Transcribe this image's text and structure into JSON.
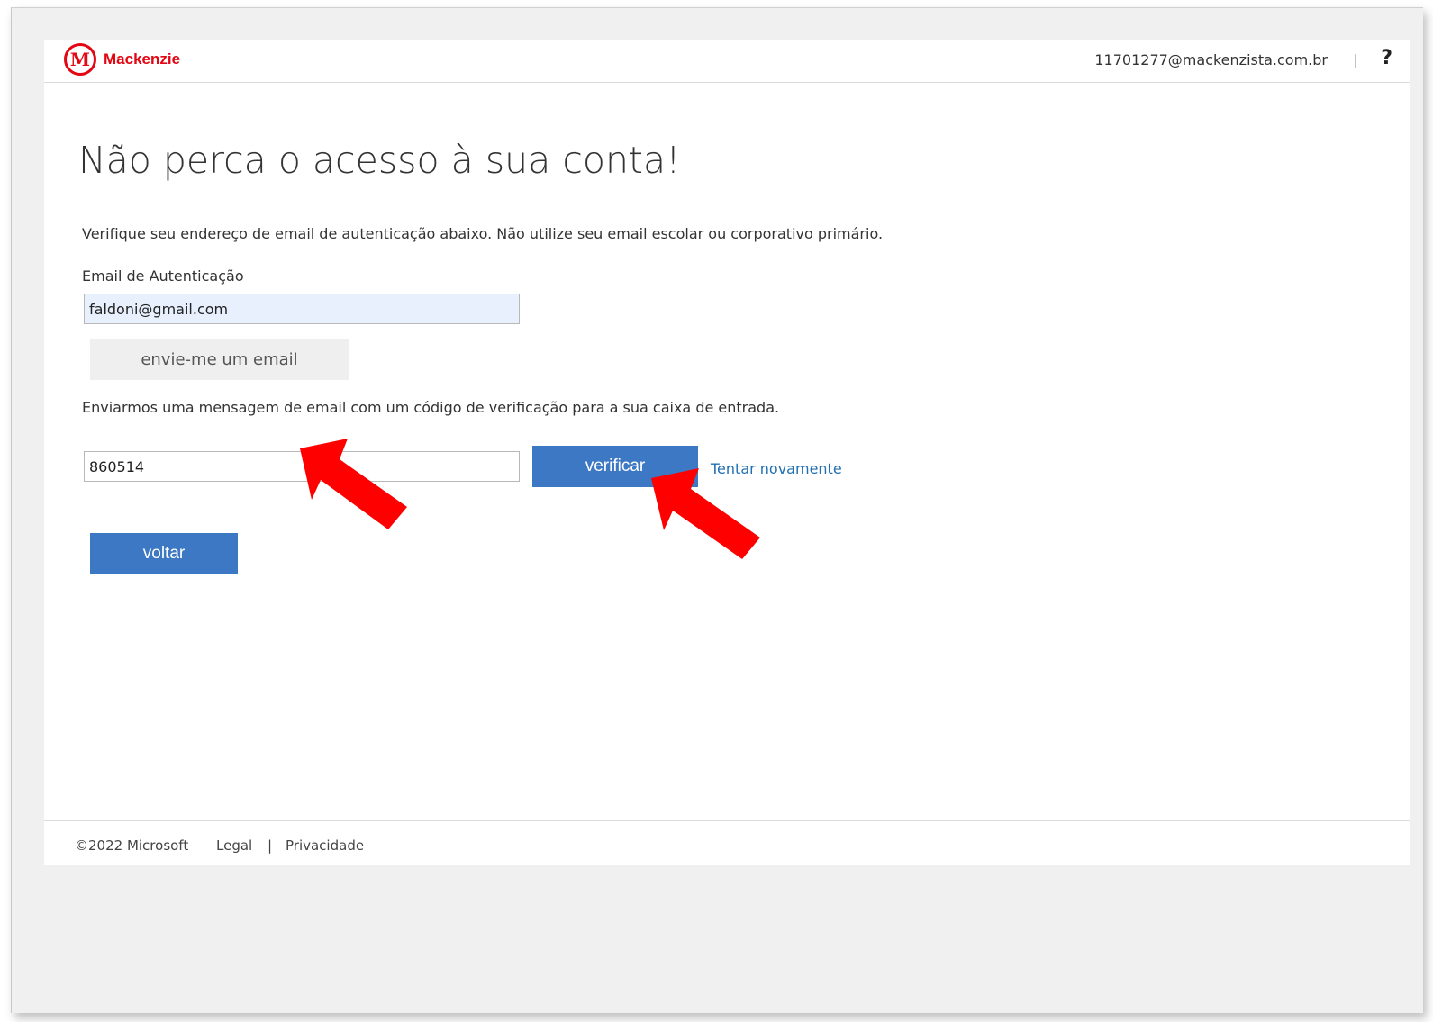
{
  "header": {
    "brand_mark": "M",
    "brand_name": "Mackenzie",
    "user_email": "11701277@mackenzista.com.br",
    "separator": "|",
    "help_label": "?"
  },
  "main": {
    "title": "Não perca o acesso à sua conta!",
    "description": "Verifique seu endereço de email de autenticação abaixo. Não utilize seu email escolar ou corporativo primário.",
    "email_label": "Email de Autenticação",
    "email_value": "faldoni@gmail.com",
    "send_label": "envie-me um email",
    "sent_message": "Enviarmos uma mensagem de email com um código de verificação para a sua caixa de entrada.",
    "code_value": "860514",
    "verify_label": "verificar",
    "retry_label": "Tentar novamente",
    "back_label": "voltar"
  },
  "footer": {
    "copyright": "©2022 Microsoft",
    "legal": "Legal",
    "separator": "|",
    "privacy": "Privacidade"
  },
  "colors": {
    "brand": "#e30613",
    "primary_button": "#3c78c3",
    "link": "#1f6fb2",
    "annotation_arrow": "#ff0000"
  }
}
